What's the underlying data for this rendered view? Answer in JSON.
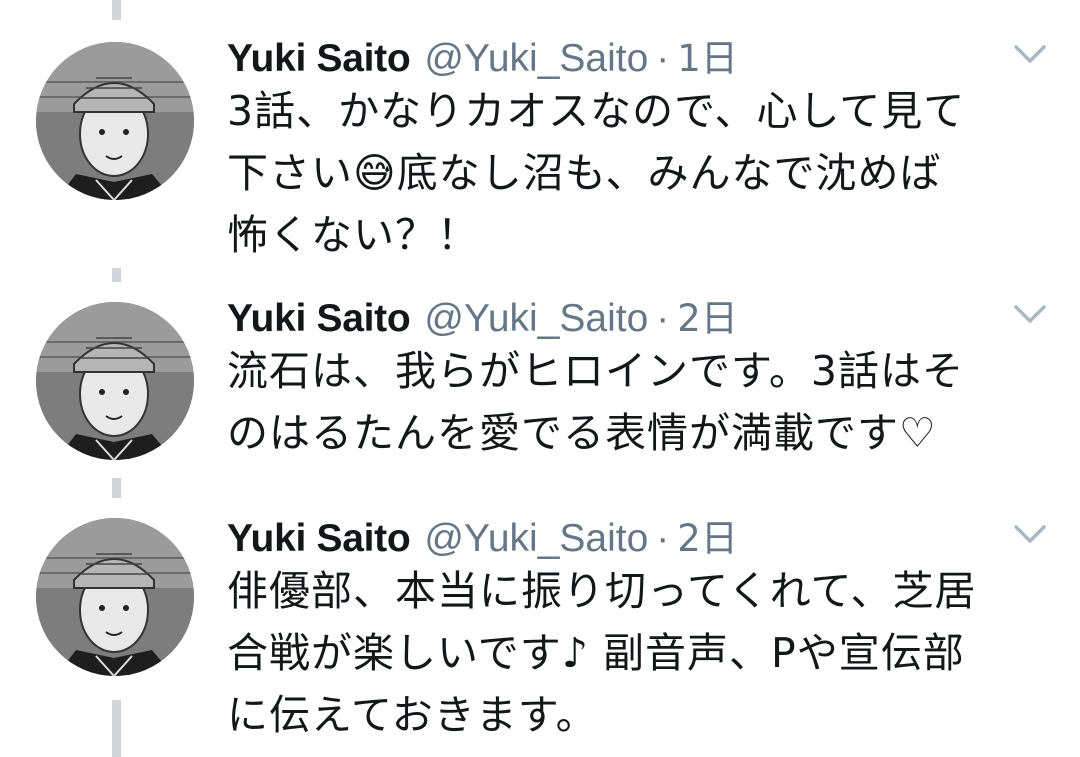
{
  "tweets": [
    {
      "name": "Yuki Saito",
      "handle": "@Yuki_Saito",
      "separator": "·",
      "time": "1日",
      "text": "3話、かなりカオスなので、心して見て\n下さい😅底なし沼も、みんなで沈めば\n怖くない？！"
    },
    {
      "name": "Yuki Saito",
      "handle": "@Yuki_Saito",
      "separator": "·",
      "time": "2日",
      "text": "流石は、我らがヒロインです。3話はそ\nのはるたんを愛でる表情が満載です♡"
    },
    {
      "name": "Yuki Saito",
      "handle": "@Yuki_Saito",
      "separator": "·",
      "time": "2日",
      "text": "俳優部、本当に振り切ってくれて、芝居\n合戦が楽しいです♪ 副音声、Pや宣伝部\nに伝えておきます。"
    }
  ],
  "colors": {
    "text_primary": "#14171a",
    "text_secondary": "#657786",
    "thread_line": "#cfd5d9",
    "caret": "#aab8c2"
  },
  "icons": {
    "caret": "chevron-down-icon",
    "avatar": "avatar"
  }
}
